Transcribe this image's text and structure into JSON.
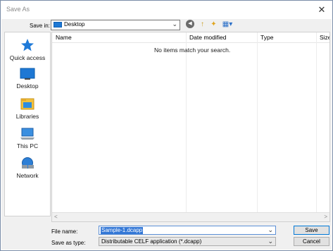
{
  "window": {
    "title": "Save As",
    "close_glyph": "✕"
  },
  "toolbar": {
    "save_in_label": "Save in:",
    "location": "Desktop",
    "back_glyph": "◀",
    "up_glyph": "↑",
    "new_folder_glyph": "✦",
    "view_glyph": "▦▾"
  },
  "places": [
    {
      "label": "Quick access",
      "icon": "star-icon"
    },
    {
      "label": "Desktop",
      "icon": "desktop-icon"
    },
    {
      "label": "Libraries",
      "icon": "libraries-icon"
    },
    {
      "label": "This PC",
      "icon": "computer-icon"
    },
    {
      "label": "Network",
      "icon": "network-icon"
    }
  ],
  "file_list": {
    "columns": [
      "Name",
      "Date modified",
      "Type",
      "Size"
    ],
    "empty_message": "No items match your search.",
    "sort_glyph": "^",
    "scroll_left": "<",
    "scroll_right": ">"
  },
  "form": {
    "file_name_label": "File name:",
    "file_name_value": "Sample-1.dcapp",
    "save_as_type_label": "Save as type:",
    "save_as_type_value": "Distributable CELF application (*.dcapp)",
    "dropdown_glyph": "⌄"
  },
  "buttons": {
    "save": "Save",
    "cancel": "Cancel"
  },
  "colors": {
    "accent": "#0078d7",
    "selection": "#3377d6",
    "folder": "#f2c13d",
    "desktop_blue": "#1e78d4"
  }
}
